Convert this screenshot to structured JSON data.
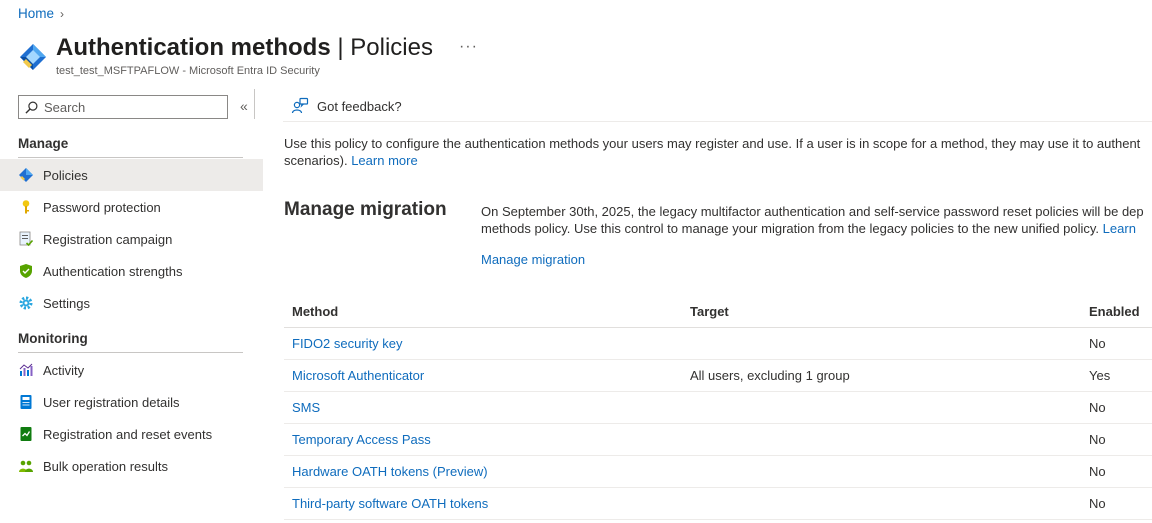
{
  "breadcrumb": {
    "home": "Home"
  },
  "header": {
    "title": "Authentication methods",
    "separator": " | ",
    "subtitle_part": "Policies",
    "more": "···",
    "tenant": "test_test_MSFTPAFLOW - Microsoft Entra ID Security"
  },
  "sidebar": {
    "search_placeholder": "Search",
    "collapse": "«",
    "manage_title": "Manage",
    "manage_items": [
      {
        "label": "Policies",
        "icon": "policy-icon",
        "active": true
      },
      {
        "label": "Password protection",
        "icon": "key-icon"
      },
      {
        "label": "Registration campaign",
        "icon": "campaign-icon"
      },
      {
        "label": "Authentication strengths",
        "icon": "shield-icon"
      },
      {
        "label": "Settings",
        "icon": "gear-icon"
      }
    ],
    "monitor_title": "Monitoring",
    "monitor_items": [
      {
        "label": "Activity",
        "icon": "activity-chart-icon"
      },
      {
        "label": "User registration details",
        "icon": "user-details-icon"
      },
      {
        "label": "Registration and reset events",
        "icon": "events-log-icon"
      },
      {
        "label": "Bulk operation results",
        "icon": "bulk-results-icon"
      }
    ]
  },
  "toolbar": {
    "feedback": "Got feedback?"
  },
  "intro": {
    "line1": "Use this policy to configure the authentication methods your users may register and use. If a user is in scope for a method, they may use it to authent",
    "line2": "scenarios).",
    "learn_more": "Learn more"
  },
  "migration": {
    "title": "Manage migration",
    "line1": "On September 30th, 2025, the legacy multifactor authentication and self-service password reset policies will be dep",
    "line2": "methods policy. Use this control to manage your migration from the legacy policies to the new unified policy.",
    "line2_link": "Learn",
    "link": "Manage migration"
  },
  "table": {
    "headers": {
      "method": "Method",
      "target": "Target",
      "enabled": "Enabled"
    },
    "rows": [
      {
        "method": "FIDO2 security key",
        "target": "",
        "enabled": "No"
      },
      {
        "method": "Microsoft Authenticator",
        "target": "All users, excluding 1 group",
        "enabled": "Yes"
      },
      {
        "method": "SMS",
        "target": "",
        "enabled": "No"
      },
      {
        "method": "Temporary Access Pass",
        "target": "",
        "enabled": "No"
      },
      {
        "method": "Hardware OATH tokens (Preview)",
        "target": "",
        "enabled": "No"
      },
      {
        "method": "Third-party software OATH tokens",
        "target": "",
        "enabled": "No"
      }
    ]
  },
  "colors": {
    "link": "#0f6cbd",
    "active_bg": "#edebe9",
    "text": "#323130"
  }
}
